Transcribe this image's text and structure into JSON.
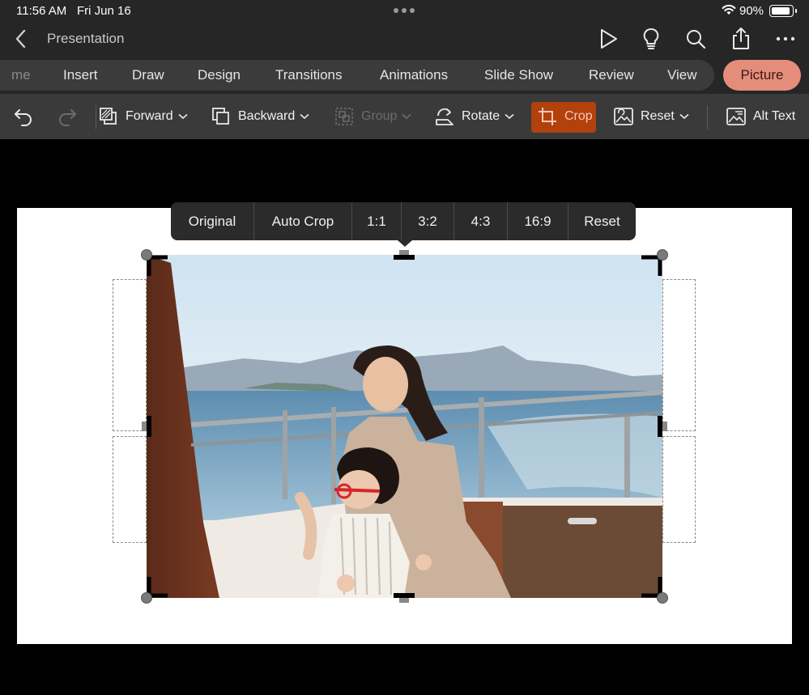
{
  "status_bar": {
    "time": "11:56 AM",
    "date": "Fri Jun 16",
    "battery": "90%",
    "battery_level": 0.9
  },
  "title_bar": {
    "back_icon": "chevron-left-icon",
    "title": "Presentation",
    "icons": [
      "play-icon",
      "lightbulb-icon",
      "search-icon",
      "share-icon",
      "more-icon"
    ]
  },
  "ribbon": {
    "tabs": [
      {
        "label": "me"
      },
      {
        "label": "Insert"
      },
      {
        "label": "Draw"
      },
      {
        "label": "Design"
      },
      {
        "label": "Transitions"
      },
      {
        "label": "Animations"
      },
      {
        "label": "Slide Show"
      },
      {
        "label": "Review"
      },
      {
        "label": "View"
      }
    ],
    "active_tab": "Picture",
    "active_color": "#e58d7b"
  },
  "toolbar": {
    "forward": "Forward",
    "backward": "Backward",
    "group": "Group",
    "rotate": "Rotate",
    "crop": "Crop",
    "reset": "Reset",
    "alt_text": "Alt Text",
    "crop_active_color": "#b3410b"
  },
  "crop_menu": {
    "options": [
      "Original",
      "Auto Crop",
      "1:1",
      "3:2",
      "4:3",
      "16:9",
      "Reset"
    ]
  }
}
